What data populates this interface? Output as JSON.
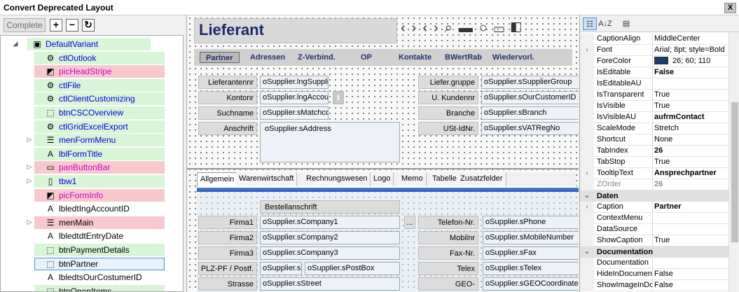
{
  "window": {
    "title": "Convert Deprecated Layout",
    "close_label": "X"
  },
  "toolbar": {
    "complete_label": "Complete",
    "expand_label": "+",
    "collapse_label": "−",
    "refresh_label": "↻"
  },
  "tree": [
    {
      "label": "DefaultVariant",
      "icon": "form-icon",
      "expander": "◢",
      "check": false,
      "hl": "green",
      "color": "blue",
      "indent": 0
    },
    {
      "label": "ctlOutlook",
      "icon": "gear-icon",
      "expander": "",
      "check": true,
      "hl": "green",
      "color": "blue",
      "indent": 1
    },
    {
      "label": "picHeadStripe",
      "icon": "image-icon",
      "expander": "",
      "check": true,
      "hl": "red",
      "color": "magenta",
      "indent": 1
    },
    {
      "label": "ctlFile",
      "icon": "gear-icon",
      "expander": "",
      "check": true,
      "hl": "green",
      "color": "blue",
      "indent": 1
    },
    {
      "label": "ctlClientCustomizing",
      "icon": "gear-icon",
      "expander": "",
      "check": true,
      "hl": "green",
      "color": "blue",
      "indent": 1
    },
    {
      "label": "btnCSCOverview",
      "icon": "cursor-icon",
      "expander": "",
      "check": true,
      "hl": "green",
      "color": "blue",
      "indent": 1
    },
    {
      "label": "ctlGridExcelExport",
      "icon": "gear-icon",
      "expander": "",
      "check": true,
      "hl": "green",
      "color": "blue",
      "indent": 1
    },
    {
      "label": "menFormMenu",
      "icon": "menu-icon",
      "expander": "▷",
      "check": true,
      "hl": "green",
      "color": "blue",
      "indent": 1
    },
    {
      "label": "lblFormTitle",
      "icon": "label-icon",
      "expander": "",
      "check": true,
      "hl": "green",
      "color": "blue",
      "indent": 1
    },
    {
      "label": "panButtonBar",
      "icon": "panel-icon",
      "expander": "▷",
      "check": true,
      "hl": "red",
      "color": "magenta",
      "indent": 1
    },
    {
      "label": "tbw1",
      "icon": "tab-icon",
      "expander": "▷",
      "check": false,
      "hl": "green",
      "color": "blue",
      "indent": 1
    },
    {
      "label": "picFormInfo",
      "icon": "image-icon",
      "expander": "",
      "check": true,
      "hl": "red",
      "color": "magenta",
      "indent": 1
    },
    {
      "label": "lbledtIngAccountID",
      "icon": "label-icon",
      "expander": "",
      "check": false,
      "hl": "",
      "color": "",
      "indent": 1
    },
    {
      "label": "menMain",
      "icon": "menu-icon",
      "expander": "▷",
      "check": true,
      "hl": "red",
      "color": "",
      "indent": 1
    },
    {
      "label": "lbledtdtEntryDate",
      "icon": "label-icon",
      "expander": "",
      "check": false,
      "hl": "",
      "color": "",
      "indent": 1
    },
    {
      "label": "btnPaymentDetails",
      "icon": "cursor-icon",
      "expander": "",
      "check": true,
      "hl": "green",
      "color": "",
      "indent": 1
    },
    {
      "label": "btnPartner",
      "icon": "cursor-icon",
      "expander": "",
      "check": true,
      "hl": "sel",
      "color": "",
      "indent": 1
    },
    {
      "label": "lbledtsOurCostumerID",
      "icon": "label-icon",
      "expander": "",
      "check": false,
      "hl": "",
      "color": "",
      "indent": 1
    },
    {
      "label": "btnOpenItems",
      "icon": "cursor-icon",
      "expander": "",
      "check": true,
      "hl": "green",
      "color": "",
      "indent": 1
    }
  ],
  "designer": {
    "form_title": "Lieferant",
    "toolstrip": "‹›‹›⌕▬○▭◧",
    "button_bar": [
      "Partner",
      "Adressen",
      "Z-Verbind.",
      "OP",
      "Kontakte",
      "BWertRab",
      "Wiedervorl."
    ],
    "left_fields": [
      {
        "label": "Lieferantennr",
        "value": "oSupplier.lngSupplie"
      },
      {
        "label": "Kontonr",
        "value": "oSupplier.lngAccou"
      },
      {
        "label": "Suchname",
        "value": "oSupplier.sMatchco"
      },
      {
        "label": "Anschrift",
        "value": "oSupplier.sAddress"
      }
    ],
    "right_fields": [
      {
        "label": "Liefer.gruppe",
        "value": "oSupplier.sSupplierGroup"
      },
      {
        "label": "U. Kundennr",
        "value": "oSupplier.sOurCustomerID"
      },
      {
        "label": "Branche",
        "value": "oSupplier.sBranch"
      },
      {
        "label": "USt-IdNr.",
        "value": "oSupplier.sVATRegNo"
      }
    ],
    "info_glyph": "ℹ",
    "page_tabs": [
      "Allgemein",
      "Warenwirtschaft",
      "Rechnungswesen",
      "Logo",
      "Memo",
      "Tabelle",
      "Zusatzfelder"
    ],
    "section_label": "Bestellanschrift",
    "lower_left": [
      {
        "label": "Firma1",
        "value": "oSupplier.sCompany1"
      },
      {
        "label": "Firma2",
        "value": "oSupplier.sCompany2"
      },
      {
        "label": "Firma3",
        "value": "oSupplier.sCompany3"
      },
      {
        "label": "PLZ-PF / Postf.",
        "value": "oSupplier.s",
        "value2": "oSupplier.sPostBox"
      },
      {
        "label": "Strasse",
        "value": "oSupplier.sStreet"
      }
    ],
    "lower_right": [
      {
        "label": "Telefon-Nr.",
        "value": "oSupplier.sPhone"
      },
      {
        "label": "Mobilnr",
        "value": "oSupplier.sMobileNumber"
      },
      {
        "label": "Fax-Nr.",
        "value": "oSupplier.sFax"
      },
      {
        "label": "Telex",
        "value": "oSupplier.sTelex"
      },
      {
        "label": "GEO-Koordinate",
        "value": "oSupplier.sGEOCoordinates"
      }
    ],
    "ellipsis_label": "..."
  },
  "properties": {
    "toolbar": {
      "categorized": "☷",
      "sort": "A↓Z",
      "pages": "▤"
    },
    "rows": [
      {
        "type": "prop",
        "name": "CaptionAlign",
        "value": "MiddleCenter",
        "bold": false,
        "expander": ""
      },
      {
        "type": "prop",
        "name": "Font",
        "value": "Arial; 8pt; style=Bold",
        "bold": false,
        "expander": "›"
      },
      {
        "type": "prop",
        "name": "ForeColor",
        "value": "26; 60; 110",
        "bold": false,
        "expander": "",
        "swatch": "#1a3c6e"
      },
      {
        "type": "prop",
        "name": "IsEditable",
        "value": "False",
        "bold": true,
        "expander": ""
      },
      {
        "type": "prop",
        "name": "IsEditableAU",
        "value": "",
        "bold": false,
        "expander": ""
      },
      {
        "type": "prop",
        "name": "IsTransparent",
        "value": "True",
        "bold": false,
        "expander": ""
      },
      {
        "type": "prop",
        "name": "IsVisible",
        "value": "True",
        "bold": false,
        "expander": ""
      },
      {
        "type": "prop",
        "name": "IsVisibleAU",
        "value": "aufrmContact",
        "bold": true,
        "expander": ""
      },
      {
        "type": "prop",
        "name": "ScaleMode",
        "value": "Stretch",
        "bold": false,
        "expander": ""
      },
      {
        "type": "prop",
        "name": "Shortcut",
        "value": "None",
        "bold": false,
        "expander": ""
      },
      {
        "type": "prop",
        "name": "TabIndex",
        "value": "26",
        "bold": true,
        "expander": ""
      },
      {
        "type": "prop",
        "name": "TabStop",
        "value": "True",
        "bold": false,
        "expander": ""
      },
      {
        "type": "prop",
        "name": "TooltipText",
        "value": "Ansprechpartner",
        "bold": true,
        "expander": "›"
      },
      {
        "type": "prop",
        "name": "ZOrder",
        "value": "26",
        "bold": true,
        "expander": "",
        "dim": true
      },
      {
        "type": "cat",
        "name": "Daten",
        "expander": "⌄"
      },
      {
        "type": "prop",
        "name": "Caption",
        "value": "Partner",
        "bold": true,
        "expander": "›"
      },
      {
        "type": "prop",
        "name": "ContextMenu",
        "value": "",
        "bold": false,
        "expander": ""
      },
      {
        "type": "prop",
        "name": "DataSource",
        "value": "",
        "bold": false,
        "expander": ""
      },
      {
        "type": "prop",
        "name": "ShowCaption",
        "value": "True",
        "bold": false,
        "expander": ""
      },
      {
        "type": "cat",
        "name": "Documentation",
        "expander": "⌄"
      },
      {
        "type": "prop",
        "name": "Documentation",
        "value": "",
        "bold": false,
        "expander": ""
      },
      {
        "type": "prop",
        "name": "HideInDocumen",
        "value": "False",
        "bold": false,
        "expander": ""
      },
      {
        "type": "prop",
        "name": "ShowImageInDc",
        "value": "False",
        "bold": false,
        "expander": ""
      }
    ]
  }
}
